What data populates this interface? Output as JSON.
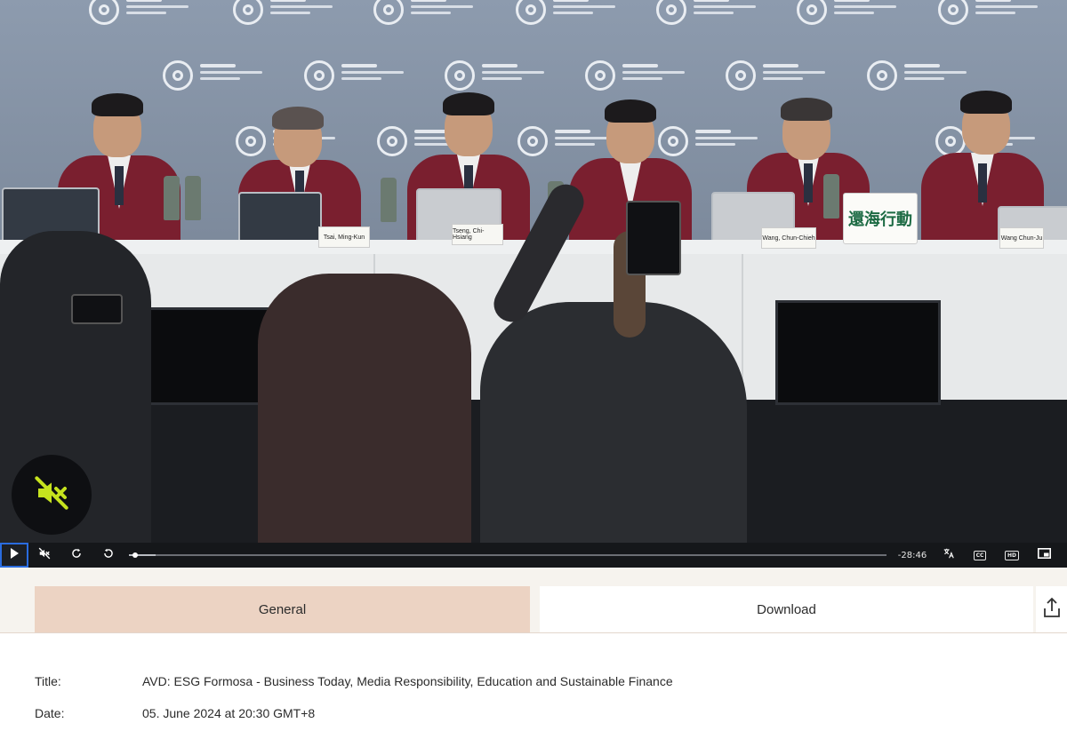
{
  "video": {
    "placards": [
      "Tsai, Ming-Kun",
      "Tseng, Chi-Hsiang",
      "Wang, Chun-Chieh",
      "Wang Chun-Ju"
    ],
    "sign_text": "還海行動",
    "remaining_time": "-28:46",
    "progress": 0.035
  },
  "controls": {
    "play_icon": "play-icon",
    "mute_icon": "muted-speaker-icon",
    "forward_icon": "rotate-forward-icon",
    "rewind_icon": "rotate-back-icon",
    "translate_icon": "translate-icon",
    "cc_label": "CC",
    "hd_label": "HD",
    "pip_icon": "picture-in-picture-icon"
  },
  "tabs": [
    {
      "label": "General",
      "active": true
    },
    {
      "label": "Download",
      "active": false
    }
  ],
  "share_icon": "share-icon",
  "details": {
    "title_label": "Title:",
    "title_value": "AVD: ESG Formosa - Business Today, Media Responsibility, Education and Sustainable Finance",
    "date_label": "Date:",
    "date_value": "05. June 2024 at 20:30 GMT+8"
  },
  "colors": {
    "active_tab": "#ecd3c3",
    "mute_accent": "#c6e31e",
    "focus_outline": "#2a6cdf"
  }
}
